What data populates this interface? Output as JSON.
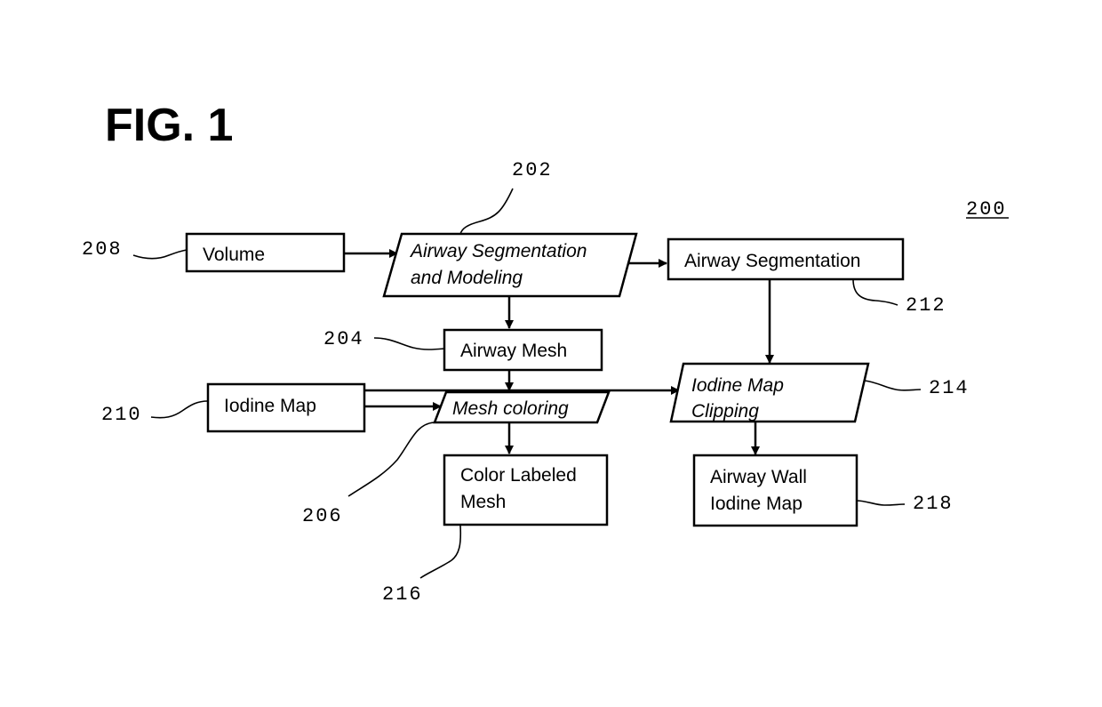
{
  "figure": {
    "title": "FIG. 1",
    "reference": "200"
  },
  "nodes": {
    "volume": {
      "ref": "208",
      "lines": [
        "Volume"
      ],
      "shape": "rectangle"
    },
    "segmentation_modeling": {
      "ref": "202",
      "lines": [
        "Airway Segmentation",
        "and Modeling"
      ],
      "shape": "parallelogram"
    },
    "airway_segmentation": {
      "ref": "212",
      "lines": [
        "Airway Segmentation"
      ],
      "shape": "rectangle"
    },
    "airway_mesh": {
      "ref": "204",
      "lines": [
        "Airway Mesh"
      ],
      "shape": "rectangle"
    },
    "iodine_map": {
      "ref": "210",
      "lines": [
        "Iodine Map"
      ],
      "shape": "rectangle"
    },
    "mesh_coloring": {
      "ref": "206",
      "lines": [
        "Mesh coloring"
      ],
      "shape": "parallelogram"
    },
    "iodine_map_clipping": {
      "ref": "214",
      "lines": [
        "Iodine Map",
        "Clipping"
      ],
      "shape": "parallelogram"
    },
    "color_labeled_mesh": {
      "ref": "216",
      "lines": [
        "Color Labeled",
        "Mesh"
      ],
      "shape": "rectangle"
    },
    "airway_wall_iodine_map": {
      "ref": "218",
      "lines": [
        "Airway Wall",
        "Iodine Map"
      ],
      "shape": "rectangle"
    }
  },
  "edges": [
    {
      "from": "Volume",
      "to": "Airway Segmentation and Modeling"
    },
    {
      "from": "Airway Segmentation and Modeling",
      "to": "Airway Segmentation"
    },
    {
      "from": "Airway Segmentation and Modeling",
      "to": "Airway Mesh"
    },
    {
      "from": "Airway Segmentation",
      "to": "Iodine Map Clipping"
    },
    {
      "from": "Airway Mesh",
      "to": "Mesh coloring"
    },
    {
      "from": "Iodine Map",
      "to": "Mesh coloring"
    },
    {
      "from": "Iodine Map",
      "to": "Iodine Map Clipping"
    },
    {
      "from": "Mesh coloring",
      "to": "Color Labeled Mesh"
    },
    {
      "from": "Iodine Map Clipping",
      "to": "Airway Wall Iodine Map"
    }
  ]
}
